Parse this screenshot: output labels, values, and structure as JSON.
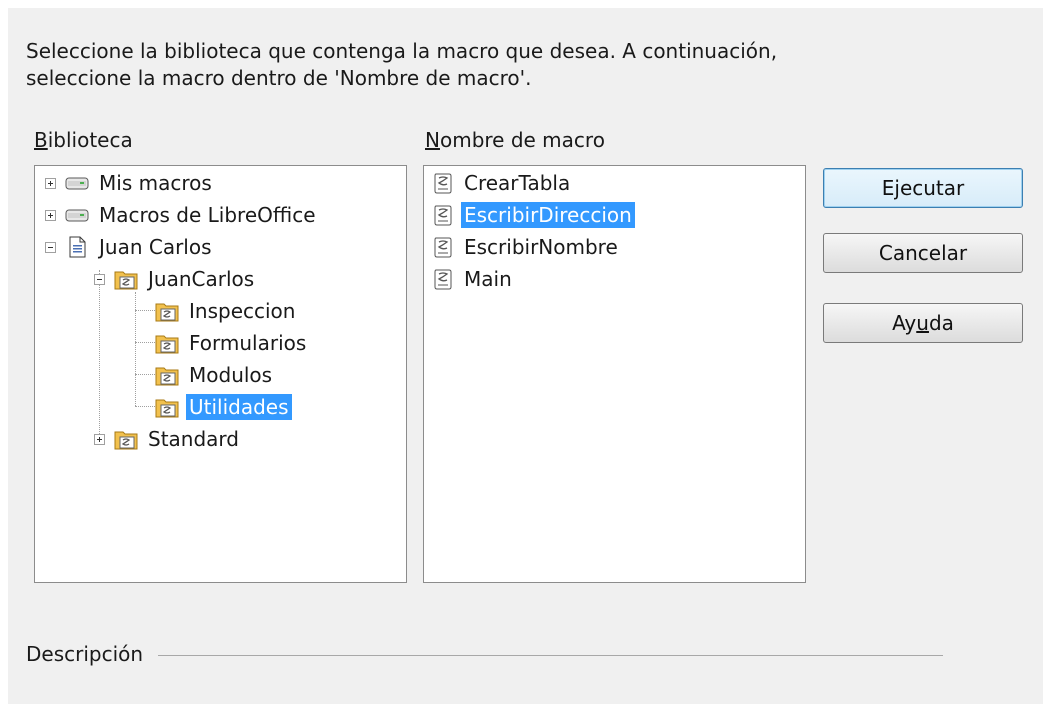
{
  "instructions": "Seleccione la biblioteca que contenga la macro que desea. A continuación, seleccione la macro dentro de 'Nombre de macro'.",
  "library": {
    "label_first": "B",
    "label_rest": "iblioteca",
    "items": [
      {
        "label": "Mis macros",
        "icon": "drive-icon",
        "expander": "plus"
      },
      {
        "label": "Macros de LibreOffice",
        "icon": "drive-icon",
        "expander": "plus"
      },
      {
        "label": "Juan Carlos",
        "icon": "document-icon",
        "expander": "minus"
      },
      {
        "label": "JuanCarlos",
        "icon": "library-folder-icon",
        "expander": "minus"
      },
      {
        "label": "Inspeccion",
        "icon": "library-folder-icon"
      },
      {
        "label": "Formularios",
        "icon": "library-folder-icon"
      },
      {
        "label": "Modulos",
        "icon": "library-folder-icon"
      },
      {
        "label": "Utilidades",
        "icon": "library-folder-icon",
        "selected": true
      },
      {
        "label": "Standard",
        "icon": "library-folder-icon",
        "expander": "plus"
      }
    ]
  },
  "macros": {
    "label_first": "N",
    "label_rest": "ombre de macro",
    "items": [
      {
        "label": "CrearTabla",
        "icon": "macro-scroll-icon"
      },
      {
        "label": "EscribirDireccion",
        "icon": "macro-scroll-icon",
        "selected": true
      },
      {
        "label": "EscribirNombre",
        "icon": "macro-scroll-icon"
      },
      {
        "label": "Main",
        "icon": "macro-scroll-icon"
      }
    ]
  },
  "buttons": {
    "run": "Ejecutar",
    "cancel": "Cancelar",
    "help_pre": "Ay",
    "help_u": "u",
    "help_post": "da"
  },
  "description_label": "Descripción",
  "colors": {
    "selection": "#3399ff",
    "dialog_bg": "#f0f0f0"
  }
}
